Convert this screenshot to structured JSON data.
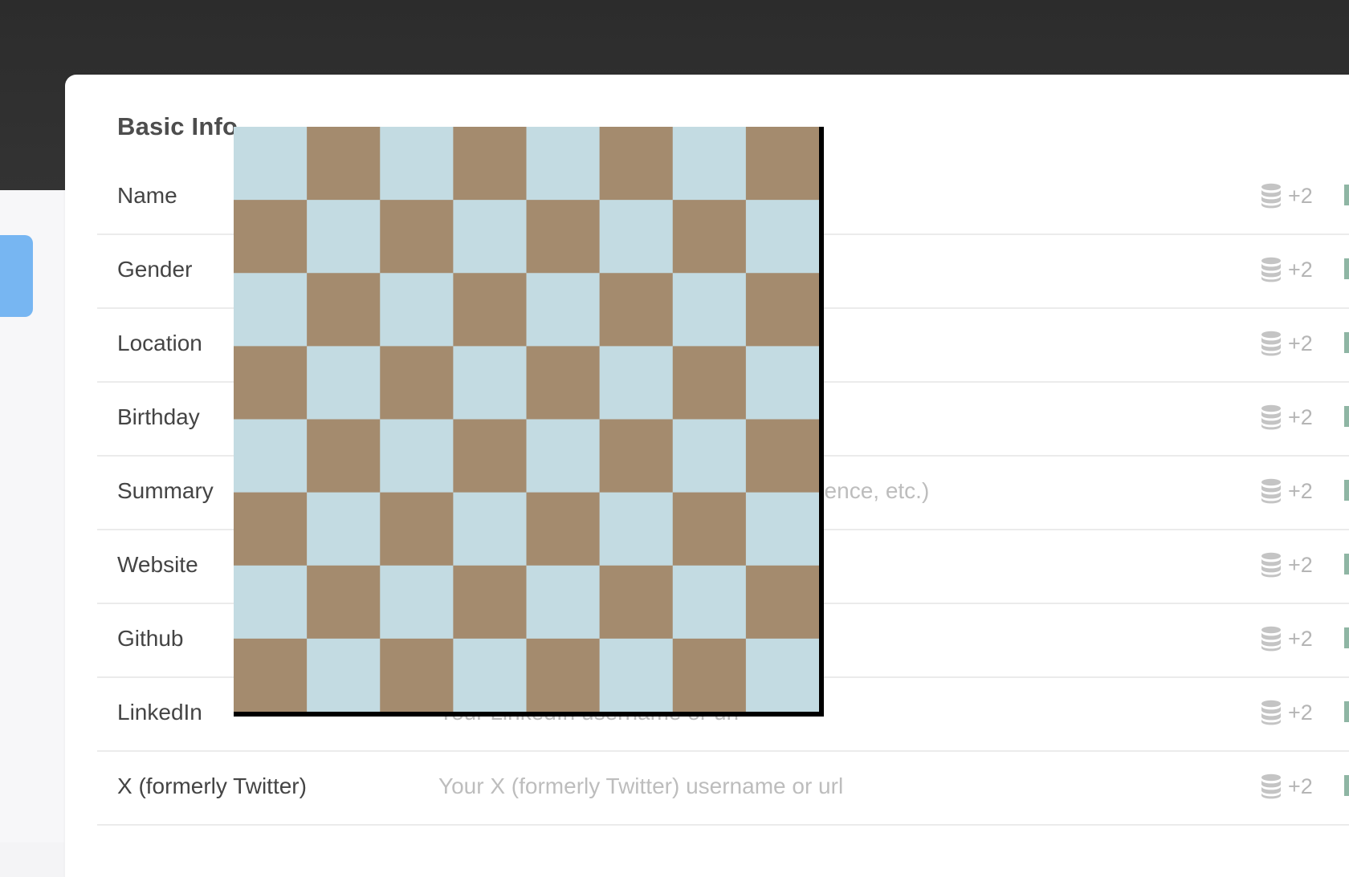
{
  "section": {
    "title": "Basic Info"
  },
  "fields": [
    {
      "label": "Name",
      "placeholder": "",
      "count": "+2"
    },
    {
      "label": "Gender",
      "placeholder": "",
      "count": "+2"
    },
    {
      "label": "Location",
      "placeholder": "",
      "count": "+2"
    },
    {
      "label": "Birthday",
      "placeholder": "",
      "count": "+2"
    },
    {
      "label": "Summary",
      "placeholder": "rience, etc.)",
      "count": "+2"
    },
    {
      "label": "Website",
      "placeholder": "",
      "count": "+2"
    },
    {
      "label": "Github",
      "placeholder": "",
      "count": "+2"
    },
    {
      "label": "LinkedIn",
      "placeholder": "Your LinkedIn username or url",
      "count": "+2"
    },
    {
      "label": "X (formerly Twitter)",
      "placeholder": "Your X (formerly Twitter) username or url",
      "count": "+2"
    }
  ],
  "icons": {
    "source": "database-icon"
  },
  "colors": {
    "accent_blue": "#77b6f2",
    "board_light": "#c3dbe2",
    "board_dark": "#a48b6e",
    "badge_gray": "#b5b5b5"
  },
  "board": {
    "rows": 8,
    "cols": 8
  }
}
